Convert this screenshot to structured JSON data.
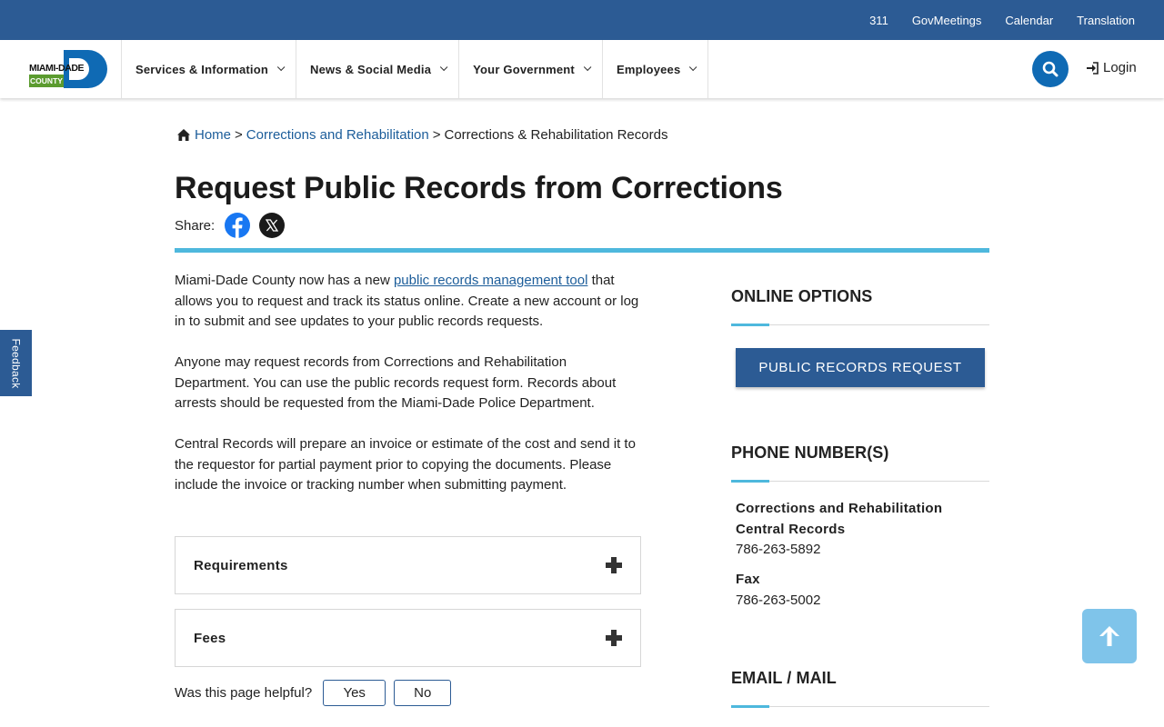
{
  "utility_bar": {
    "links": [
      "311",
      "GovMeetings",
      "Calendar",
      "Translation"
    ]
  },
  "header": {
    "logo": {
      "top_text": "MIAMI-DADE",
      "bottom_text": "COUNTY"
    },
    "nav": [
      {
        "label": "Services & Information"
      },
      {
        "label": "News & Social Media"
      },
      {
        "label": "Your Government"
      },
      {
        "label": "Employees"
      }
    ],
    "search_icon": "search-icon",
    "login_label": "Login",
    "colors": {
      "bar": "#2c5b94",
      "accent": "#0f6ab4"
    }
  },
  "breadcrumb": {
    "home": "Home",
    "sep1": ">",
    "level1": "Corrections and Rehabilitation",
    "sep2": ">",
    "current": "Corrections & Rehabilitation Records"
  },
  "page": {
    "title": "Request Public Records from Corrections",
    "share_label": "Share:"
  },
  "content": {
    "p1_before": "Miami-Dade County now has a new ",
    "p1_link": "public records management tool",
    "p1_after": " that allows you to request and track its status online. Create a new account or log in to submit and see updates to your public records requests.",
    "p2": "Anyone may request records from Corrections and Rehabilitation Department. You can use the public records request form. Records about arrests should be requested from the Miami-Dade Police Department.",
    "p3": "Central Records will prepare an invoice or estimate of the cost and send it to the requestor for partial payment prior to copying the documents. Please include the invoice or tracking number when submitting payment."
  },
  "accordions": [
    {
      "label": "Requirements"
    },
    {
      "label": "Fees"
    }
  ],
  "helpful": {
    "question": "Was this page helpful?",
    "yes": "Yes",
    "no": "No"
  },
  "sidebar": {
    "online_heading": "ONLINE OPTIONS",
    "public_records_button": "PUBLIC RECORDS REQUEST",
    "phone_heading": "PHONE NUMBER(S)",
    "contacts": [
      {
        "name_line1": "Corrections and Rehabilitation",
        "name_line2": "Central Records",
        "phone": "786-263-5892"
      },
      {
        "name_line1": "Fax",
        "phone": "786-263-5002"
      }
    ],
    "email_heading": "EMAIL / MAIL"
  },
  "feedback_label": "Feedback"
}
